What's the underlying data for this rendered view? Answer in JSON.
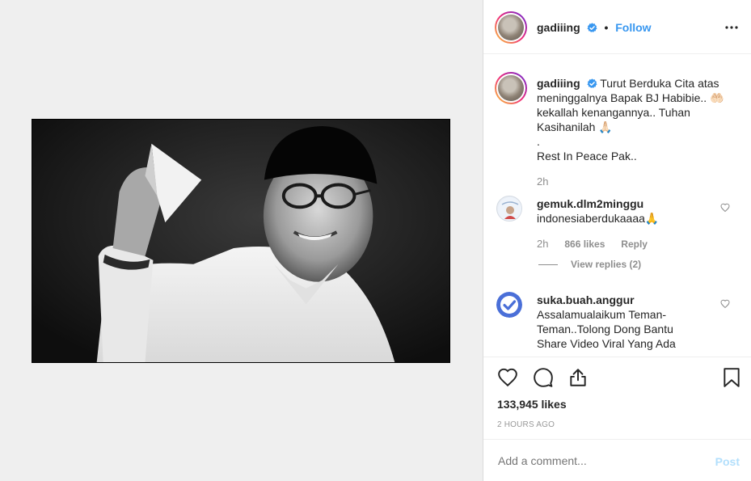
{
  "header": {
    "username": "gadiiing",
    "separator": "•",
    "follow_label": "Follow",
    "more_icon": "more-horizontal-icon"
  },
  "caption": {
    "username": "gadiiing",
    "line1": "Turut Berduka Cita atas",
    "line2": "meninggalnya Bapak BJ Habibie..",
    "emoji1": "🤲🏻",
    "line3": "kekallah kenangannya.. Tuhan",
    "line4": "Kasihanilah",
    "emoji2": "🙏🏻",
    "line5": ".",
    "line6": "Rest In Peace Pak..",
    "time": "2h"
  },
  "comments": [
    {
      "username": "gemuk.dlm2minggu",
      "text": "indonesiaberdukaaaa",
      "emoji": "🙏",
      "time": "2h",
      "likes": "866 likes",
      "reply_label": "Reply",
      "view_replies": "View replies (2)"
    },
    {
      "username": "suka.buah.anggur",
      "text_line1": "Assalamualaikum Teman-",
      "text_line2": "Teman..Tolong Dong Bantu",
      "text_line3": "Share Video Viral Yang Ada"
    }
  ],
  "actions": {
    "like_icon": "heart-icon",
    "comment_icon": "comment-icon",
    "share_icon": "share-icon",
    "save_icon": "bookmark-icon"
  },
  "likes_count": "133,945 likes",
  "timestamp": "2 HOURS AGO",
  "comment_box": {
    "placeholder": "Add a comment...",
    "post_label": "Post"
  },
  "colors": {
    "accent": "#3897f0",
    "verified": "#3897f0",
    "muted": "#8e8e8e",
    "post_disabled": "#b2dffc"
  }
}
